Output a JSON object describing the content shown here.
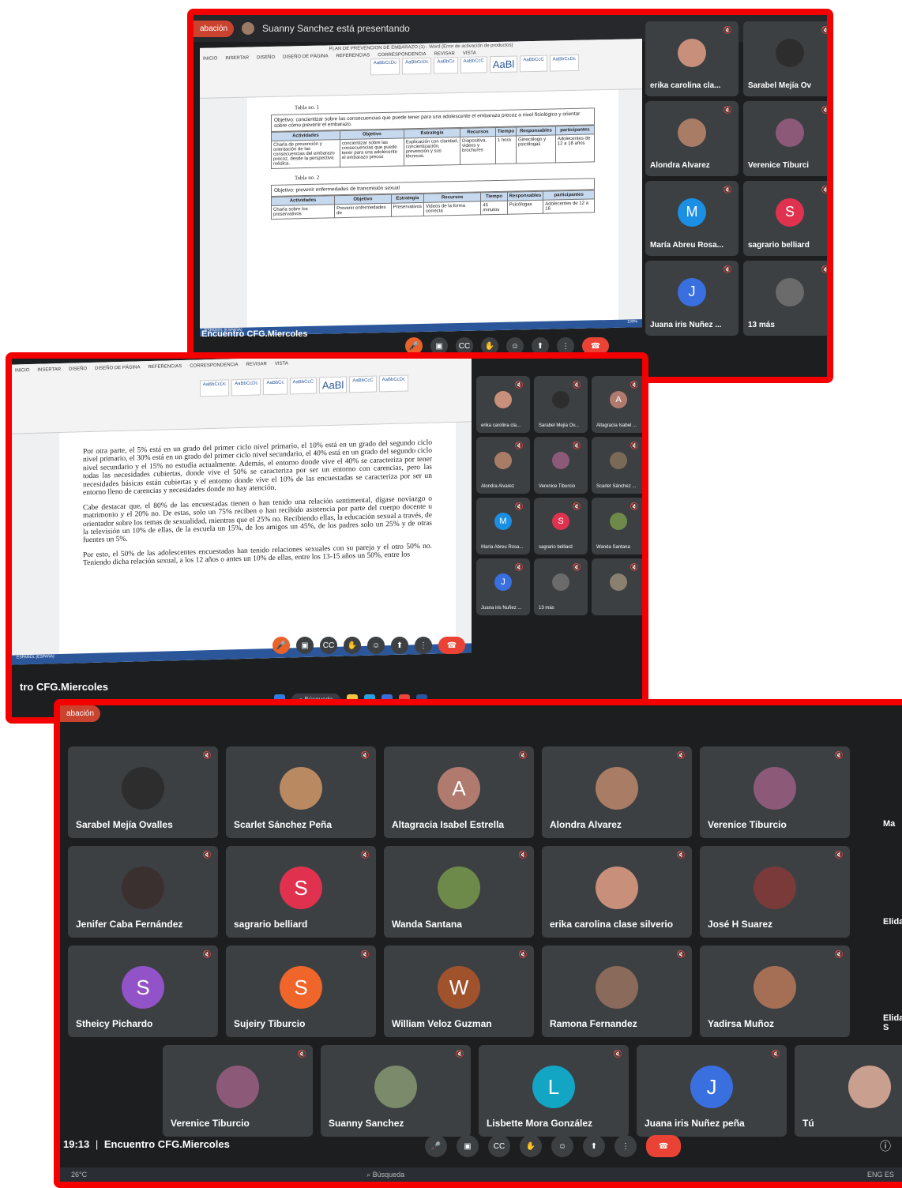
{
  "frame1": {
    "presenting": "Suanny Sanchez está presentando",
    "recording": "abación",
    "word_title": "PLAN DE PREVENCION DE EMBARAZO (1) - Word (Error de activación de productos)",
    "tabs": [
      "INICIO",
      "INSERTAR",
      "DISEÑO",
      "DISEÑO DE PÁGINA",
      "REFERENCIAS",
      "CORRESPONDENCIA",
      "REVISAR",
      "VISTA"
    ],
    "styles": [
      "AaBbCcDc",
      "AaBbCcDc",
      "AaBbCc",
      "AaBbCcC",
      "AaBl",
      "AaBbCcC",
      "AaBbCcDc"
    ],
    "table1_caption": "Tabla no. 1",
    "table1_objective": "Objetivo: concientizar sobre las consecuencias que puede tener para una adolescente el embarazo precoz a nivel fisiológico y orientar sobre cómo prevenir el embarazo.",
    "table_headers": [
      "Actividades",
      "Objetivo",
      "Estrategia",
      "Recursos",
      "Tiempo",
      "Responsables",
      "participantes"
    ],
    "table1_row": [
      "Charla de prevención y orientación de las consecuencias del embarazo precoz, desde la perspectiva médica.",
      "concientizar sobre las consecuencias que puede tener para una adolecente el embarazo precoz",
      "Explicación con claridad, concientización, prevención y sus técnicos.",
      "Diapositiva, videos y brochures",
      "1 hora",
      "Ginecólogo y psicólogas",
      "Adolecentes de 12 a 18 años"
    ],
    "table2_caption": "Tabla no. 2",
    "table2_objective": "Objetivo: prevenir enfermedades de transmisión sexual",
    "table2_row": [
      "Charla sobre los preservativos",
      "Prevenir enfermedades de",
      "Preservativos",
      "Videos de la forma correcta",
      "45 minutos",
      "Psicólogas",
      "Adolecentes de 12 a 16"
    ],
    "status": "ESPAÑOL (ESPAÑA)",
    "zoom": "100%",
    "tiles": [
      {
        "name": "erika carolina cla...",
        "color": "#c88f7a",
        "letter": ""
      },
      {
        "name": "Sarabel Mejía Ov",
        "color": "#2d2d2d",
        "letter": ""
      },
      {
        "name": "Alondra Alvarez",
        "color": "#a97c65",
        "letter": ""
      },
      {
        "name": "Verenice Tiburci",
        "color": "#8c5a78",
        "letter": ""
      },
      {
        "name": "María Abreu Rosa...",
        "color": "#1a8fe3",
        "letter": "M"
      },
      {
        "name": "sagrario belliard",
        "color": "#e0324f",
        "letter": "S"
      },
      {
        "name": "Juana iris Nuñez ...",
        "color": "#3a6fe0",
        "letter": "J"
      },
      {
        "name": "13 más",
        "color": "#6b6b6b",
        "letter": ""
      }
    ],
    "meeting": "Encuentro CFG.Miercoles"
  },
  "frame2": {
    "p1": "Por otra parte, el 5% está en un grado del primer ciclo nivel primario, el 10% está en un grado del segundo ciclo nivel primario, el 30% está en un grado del primer ciclo nivel secundario, el 40% está en un grado del segundo ciclo nivel secundario y el 15% no estudia actualmente. Además, el entorno donde vive el 40% se caracteriza por tener todas las necesidades cubiertas, donde vive el 50% se caracteriza por ser un entorno con carencias, pero las necesidades básicas están cubiertas y el entorno donde vive el 10% de las encuestadas se caracteriza por ser un entorno lleno de carencias y necesidades donde no hay atención.",
    "p2": "Cabe destacar que, el 80% de las encuestadas tienen o han tenido una relación sentimental, dígase noviazgo o matrimonio y el 20% no. De estas, solo un 75% reciben o han recibido asistencia por parte del cuerpo docente u orientador sobre los temas de sexualidad, mientras que el 25% no. Recibiendo ellas, la educación sexual a través, de la televisión un 10% de ellas, de la escuela un 15%, de los amigos un 45%, de los padres solo un 25% y de otras fuentes un 5%.",
    "p3": "Por esto, el 50% de las adolescentes encuestadas han tenido relaciones sexuales con su pareja y el otro 50% no. Teniendo dicha relación sexual, a los 12 años o antes un 10% de ellas, entre los 13-15 años un 50%, entre los",
    "tiles": [
      {
        "name": "erika carolina cla...",
        "color": "#c88f7a",
        "letter": ""
      },
      {
        "name": "Sarabel Mejía Ov...",
        "color": "#2d2d2d",
        "letter": ""
      },
      {
        "name": "Altagracia Isabel ...",
        "color": "#b07b6e",
        "letter": "A"
      },
      {
        "name": "Alondra Alvarez",
        "color": "#a97c65",
        "letter": ""
      },
      {
        "name": "Verenice Tiburcio",
        "color": "#8c5a78",
        "letter": ""
      },
      {
        "name": "Scarlet Sánchez ...",
        "color": "#7a6a55",
        "letter": ""
      },
      {
        "name": "María Abreu Rosa...",
        "color": "#1a8fe3",
        "letter": "M"
      },
      {
        "name": "sagrario belliard",
        "color": "#e0324f",
        "letter": "S"
      },
      {
        "name": "Wanda Santana",
        "color": "#6d8a4a",
        "letter": ""
      },
      {
        "name": "Juana iris Nuñez ...",
        "color": "#3a6fe0",
        "letter": "J"
      },
      {
        "name": "13 más",
        "color": "#6b6b6b",
        "letter": ""
      },
      {
        "name": "",
        "color": "#8a8070",
        "letter": ""
      }
    ],
    "status": "ESPAÑOL (ESPAÑA)",
    "meeting": "tro CFG.Miercoles",
    "search": "Búsqueda"
  },
  "frame3": {
    "recording": "abación",
    "rows": [
      [
        {
          "name": "Sarabel Mejía Ovalles",
          "color": "#2d2d2d",
          "letter": ""
        },
        {
          "name": "Scarlet Sánchez Peña",
          "color": "#b98a62",
          "letter": ""
        },
        {
          "name": "Altagracia Isabel Estrella",
          "color": "#b07b6e",
          "letter": "A"
        },
        {
          "name": "Alondra Alvarez",
          "color": "#a97c65",
          "letter": ""
        },
        {
          "name": "Verenice Tiburcio",
          "color": "#8c5a78",
          "letter": ""
        }
      ],
      [
        {
          "name": "Jenifer Caba Fernández",
          "color": "#3b3030",
          "letter": ""
        },
        {
          "name": "sagrario belliard",
          "color": "#e0324f",
          "letter": "S"
        },
        {
          "name": "Wanda Santana",
          "color": "#6d8a4a",
          "letter": ""
        },
        {
          "name": "erika carolina clase silverio",
          "color": "#c88f7a",
          "letter": ""
        },
        {
          "name": "José H Suarez",
          "color": "#7a3a3a",
          "letter": ""
        }
      ],
      [
        {
          "name": "Stheicy Pichardo",
          "color": "#9153c7",
          "letter": "S"
        },
        {
          "name": "Sujeiry Tiburcio",
          "color": "#f0662a",
          "letter": "S"
        },
        {
          "name": "William Veloz Guzman",
          "color": "#a0522d",
          "letter": "W"
        },
        {
          "name": "Ramona Fernandez",
          "color": "#8a6a5a",
          "letter": ""
        },
        {
          "name": "Yadirsa Muñoz",
          "color": "#a46f55",
          "letter": ""
        }
      ],
      [
        {
          "name": "Verenice Tiburcio",
          "color": "#8c5a78",
          "letter": ""
        },
        {
          "name": "Suanny Sanchez",
          "color": "#7a8a6a",
          "letter": ""
        },
        {
          "name": "Lisbette Mora González",
          "color": "#12a5c4",
          "letter": "L"
        },
        {
          "name": "Juana iris Nuñez peña",
          "color": "#3a6fe0",
          "letter": "J"
        },
        {
          "name": "Tú",
          "color": "#c9a090",
          "letter": ""
        }
      ]
    ],
    "edge_names": [
      "Ma",
      "Elida",
      "Elida S"
    ],
    "time": "19:13",
    "separator": "|",
    "meeting": "Encuentro CFG.Miercoles",
    "temp": "26°C",
    "search": "Búsqueda",
    "lang": "ENG ES"
  }
}
